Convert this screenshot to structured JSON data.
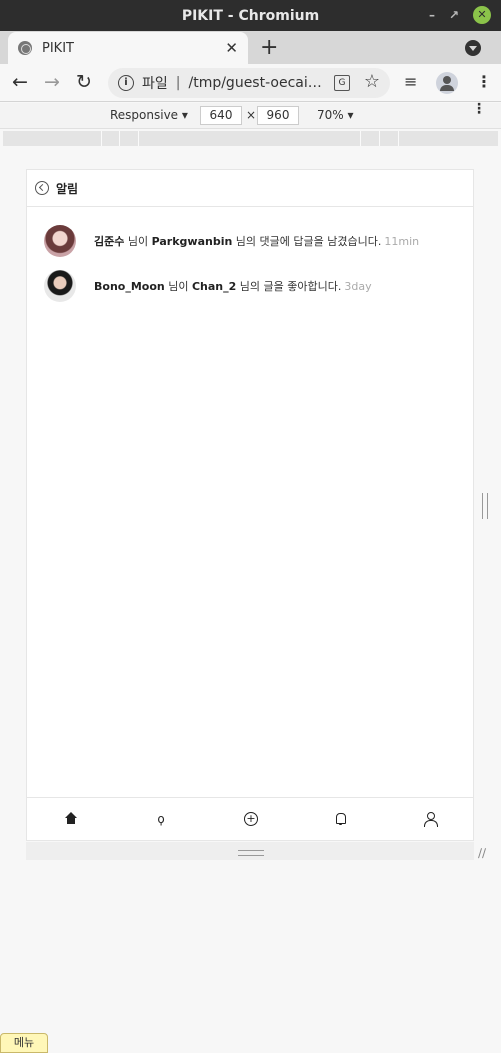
{
  "window": {
    "title": "PIKIT - Chromium"
  },
  "tab": {
    "title": "PIKIT"
  },
  "omnibox": {
    "scheme_label": "파일",
    "url": "/tmp/guest-oecai…"
  },
  "device_toolbar": {
    "mode": "Responsive",
    "width": "640",
    "height": "960",
    "zoom": "70%",
    "times": "×"
  },
  "app": {
    "header_title": "알림",
    "notifications": [
      {
        "actor": "김준수",
        "mid1": " 님이 ",
        "target": "Parkgwanbin",
        "rest": " 님의 댓글에 답글을 남겼습니다.",
        "time": "11min"
      },
      {
        "actor": "Bono_Moon",
        "mid1": " 님이 ",
        "target": "Chan_2",
        "rest": " 님의 글을 좋아합니다.",
        "time": "3day"
      }
    ]
  },
  "footer": {
    "menu_label": "메뉴"
  }
}
